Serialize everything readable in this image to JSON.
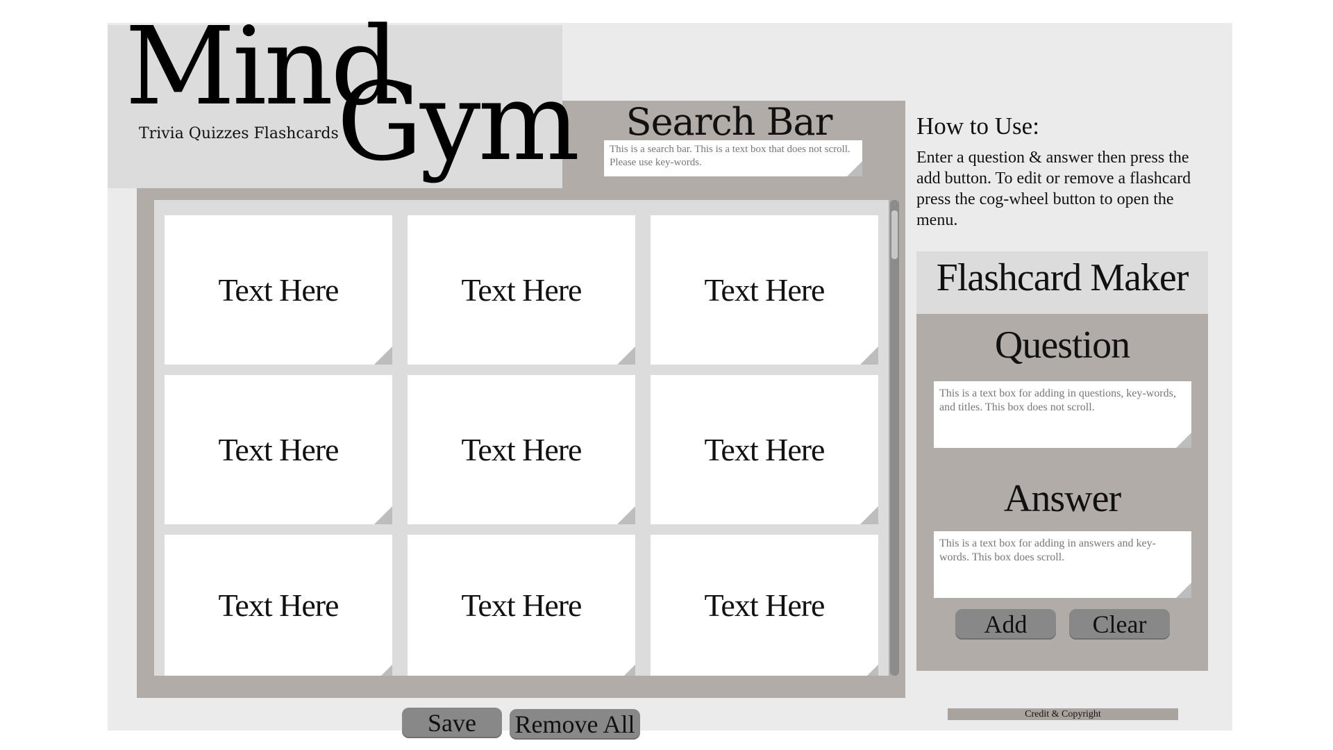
{
  "logo": {
    "word1": "Mind",
    "word2": "Gym",
    "tagline": "Trivia Quizzes Flashcards"
  },
  "search": {
    "title": "Search Bar",
    "placeholder": "This is a search bar. This is a text box that does not scroll. Please use key-words."
  },
  "flashcards": [
    {
      "label": "Text Here"
    },
    {
      "label": "Text Here"
    },
    {
      "label": "Text Here"
    },
    {
      "label": "Text Here"
    },
    {
      "label": "Text Here"
    },
    {
      "label": "Text Here"
    },
    {
      "label": "Text Here"
    },
    {
      "label": "Text Here"
    },
    {
      "label": "Text Here"
    }
  ],
  "actions": {
    "save_label": "Save",
    "remove_all_label": "Remove All"
  },
  "howto": {
    "title": "How to Use:",
    "text": "Enter a question & answer then press the add button. To edit or remove a flashcard press the cog-wheel button to open the menu."
  },
  "maker": {
    "title": "Flashcard Maker",
    "question_label": "Question",
    "question_placeholder": "This is a text box for adding in questions, key-words, and titles. This box does not scroll.",
    "answer_label": "Answer",
    "answer_placeholder": "This is a text box for adding in answers and key-words. This box does scroll.",
    "add_label": "Add",
    "clear_label": "Clear"
  },
  "footer": {
    "credit": "Credit & Copyright"
  },
  "colors": {
    "panel": "#b1aca7",
    "light": "#dcdcdc",
    "frame": "#ebebeb",
    "button": "#888888"
  }
}
